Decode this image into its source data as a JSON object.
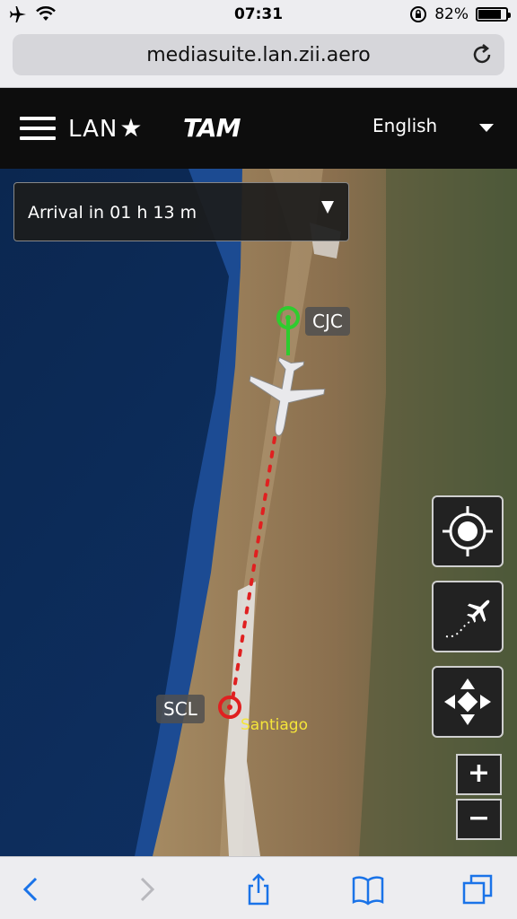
{
  "status_bar": {
    "time": "07:31",
    "battery_percent": "82%",
    "battery_level": 0.82,
    "icons": [
      "airplane-icon",
      "wifi-icon",
      "rotation-lock-icon",
      "battery-icon"
    ]
  },
  "browser": {
    "url": "mediasuite.lan.zii.aero",
    "toolbar_icons": [
      "back-icon",
      "forward-icon",
      "share-icon",
      "bookmarks-icon",
      "tabs-icon"
    ]
  },
  "header": {
    "logo_lan": "LAN",
    "logo_tam": "TAM",
    "language": "English"
  },
  "flight": {
    "arrival_status": "Arrival in 01 h 13 m",
    "destination_code": "CJC",
    "origin_code": "SCL",
    "origin_city": "Santiago"
  },
  "map_controls": {
    "center_icon": "locate-icon",
    "flight_path_icon": "flight-path-icon",
    "pan_icon": "pan-arrows-icon",
    "zoom_in_label": "+",
    "zoom_out_label": "−"
  },
  "colors": {
    "ocean": "#0c2a5c",
    "land": "#8a7456",
    "path_green": "#2ecc2e",
    "path_red": "#e02020",
    "city_label": "#f5e53a"
  }
}
